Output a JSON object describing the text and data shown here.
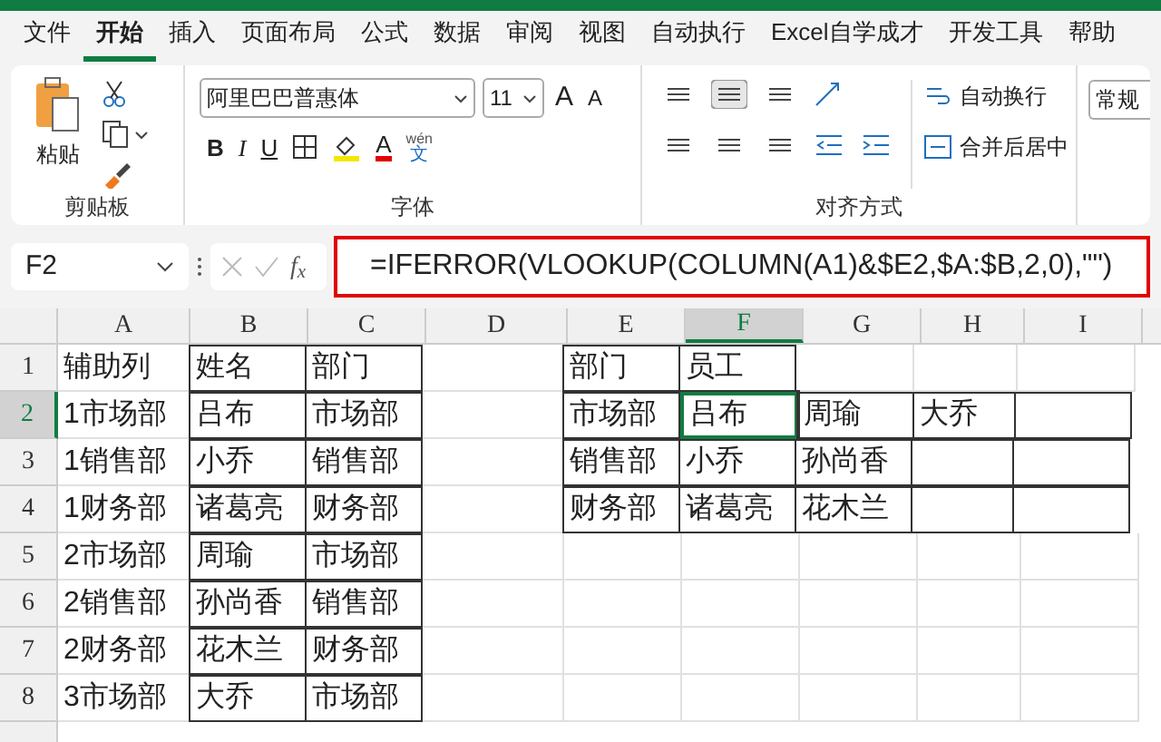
{
  "menu_tabs": [
    {
      "label": "文件",
      "selected": false
    },
    {
      "label": "开始",
      "selected": true
    },
    {
      "label": "插入",
      "selected": false
    },
    {
      "label": "页面布局",
      "selected": false
    },
    {
      "label": "公式",
      "selected": false
    },
    {
      "label": "数据",
      "selected": false
    },
    {
      "label": "审阅",
      "selected": false
    },
    {
      "label": "视图",
      "selected": false
    },
    {
      "label": "自动执行",
      "selected": false
    },
    {
      "label": "Excel自学成才",
      "selected": false
    },
    {
      "label": "开发工具",
      "selected": false
    },
    {
      "label": "帮助",
      "selected": false
    }
  ],
  "ribbon": {
    "clipboard": {
      "paste_label": "粘贴",
      "group_label": "剪贴板"
    },
    "font": {
      "font_name": "阿里巴巴普惠体",
      "font_size": "11",
      "grow_label": "A",
      "shrink_label": "A",
      "bold_label": "B",
      "italic_label": "I",
      "underline_label": "U",
      "fill_label": "A",
      "phonetic_top": "wén",
      "phonetic_bottom": "文",
      "group_label": "字体"
    },
    "alignment": {
      "wrap_label": "自动换行",
      "merge_label": "合并后居中",
      "group_label": "对齐方式"
    },
    "number": {
      "format": "常规"
    }
  },
  "formula_bar": {
    "name_box": "F2",
    "function_label": "f$_{x}$",
    "formula": "=IFERROR(VLOOKUP(COLUMN(A1)&$E2,$A:$B,2,0),\"\"",
    "formula_end": ")",
    "highlighted": true
  },
  "sheet": {
    "columns": [
      {
        "label": "A",
        "selected": false
      },
      {
        "label": "B",
        "selected": false
      },
      {
        "label": "C",
        "selected": false
      },
      {
        "label": "D",
        "selected": false
      },
      {
        "label": "E",
        "selected": false
      },
      {
        "label": "F",
        "selected": true
      },
      {
        "label": "G",
        "selected": false
      },
      {
        "label": "H",
        "selected": false
      },
      {
        "label": "I",
        "selected": false
      }
    ],
    "rows": [
      {
        "header": "1",
        "selected": false,
        "cells": [
          "辅助列",
          "姓名",
          "部门",
          "",
          "部门",
          "员工",
          "",
          "",
          ""
        ],
        "bordered": [
          false,
          true,
          true,
          false,
          true,
          true,
          false,
          false,
          false
        ]
      },
      {
        "header": "2",
        "selected": true,
        "cells": [
          "1市场部",
          "吕布",
          "市场部",
          "",
          "市场部",
          "吕布",
          "周瑜",
          "大乔",
          ""
        ],
        "bordered": [
          false,
          true,
          true,
          false,
          true,
          true,
          true,
          true,
          true
        ]
      },
      {
        "header": "3",
        "selected": false,
        "cells": [
          "1销售部",
          "小乔",
          "销售部",
          "",
          "销售部",
          "小乔",
          "孙尚香",
          "",
          ""
        ],
        "bordered": [
          false,
          true,
          true,
          false,
          true,
          true,
          true,
          true,
          true
        ]
      },
      {
        "header": "4",
        "selected": false,
        "cells": [
          "1财务部",
          "诸葛亮",
          "财务部",
          "",
          "财务部",
          "诸葛亮",
          "花木兰",
          "",
          ""
        ],
        "bordered": [
          false,
          true,
          true,
          false,
          true,
          true,
          true,
          true,
          true
        ]
      },
      {
        "header": "5",
        "selected": false,
        "cells": [
          "2市场部",
          "周瑜",
          "市场部",
          "",
          "",
          "",
          "",
          "",
          ""
        ],
        "bordered": [
          false,
          true,
          true,
          false,
          false,
          false,
          false,
          false,
          false
        ]
      },
      {
        "header": "6",
        "selected": false,
        "cells": [
          "2销售部",
          "孙尚香",
          "销售部",
          "",
          "",
          "",
          "",
          "",
          ""
        ],
        "bordered": [
          false,
          true,
          true,
          false,
          false,
          false,
          false,
          false,
          false
        ]
      },
      {
        "header": "7",
        "selected": false,
        "cells": [
          "2财务部",
          "花木兰",
          "财务部",
          "",
          "",
          "",
          "",
          "",
          ""
        ],
        "bordered": [
          false,
          true,
          true,
          false,
          false,
          false,
          false,
          false,
          false
        ]
      },
      {
        "header": "8",
        "selected": false,
        "cells": [
          "3市场部",
          "大乔",
          "市场部",
          "",
          "",
          "",
          "",
          "",
          ""
        ],
        "bordered": [
          false,
          true,
          true,
          false,
          false,
          false,
          false,
          false,
          false
        ]
      }
    ]
  }
}
